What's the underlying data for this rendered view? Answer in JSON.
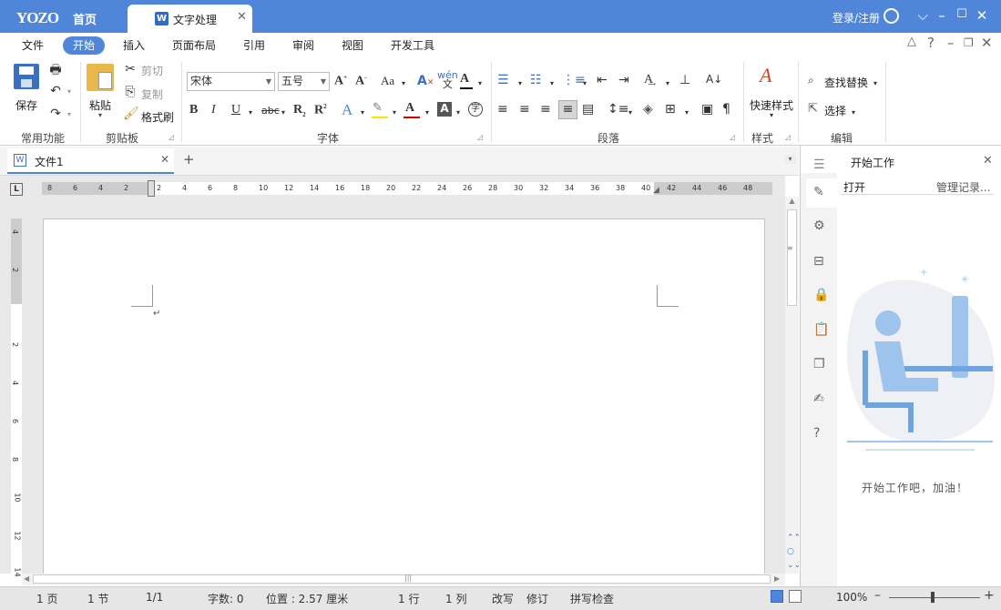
{
  "titlebar": {
    "logo": "YOZO",
    "home_tab": "首页",
    "doc_tab": "文字处理",
    "login": "登录/注册"
  },
  "menu": [
    "文件",
    "开始",
    "插入",
    "页面布局",
    "引用",
    "审阅",
    "视图",
    "开发工具"
  ],
  "active_menu": "开始",
  "ribbon": {
    "save": "保存",
    "group_common": "常用功能",
    "paste": "粘贴",
    "cut": "剪切",
    "copy": "复制",
    "format_painter": "格式刷",
    "group_clipboard": "剪贴板",
    "font_name": "宋体",
    "font_size": "五号",
    "group_font": "字体",
    "group_paragraph": "段落",
    "quick_style": "快速样式",
    "group_style": "样式",
    "find_replace": "查找替换",
    "select": "选择",
    "group_edit": "编辑",
    "colors": {
      "highlight": "#f5e600",
      "font_red": "#e00000",
      "accent": "#4f86d9"
    }
  },
  "document": {
    "tab": "文件1",
    "hruler": [
      "8",
      "6",
      "4",
      "2",
      "2",
      "4",
      "6",
      "8",
      "10",
      "12",
      "14",
      "16",
      "18",
      "20",
      "22",
      "24",
      "26",
      "28",
      "30",
      "32",
      "34",
      "36",
      "38",
      "40",
      "42",
      "44",
      "46",
      "48"
    ],
    "vruler": [
      "4",
      "2",
      "2",
      "4",
      "6",
      "8",
      "10",
      "12",
      "14"
    ]
  },
  "side_panel": {
    "title": "开始工作",
    "open": "打开",
    "manage": "管理记录...",
    "message": "开始工作吧，加油！"
  },
  "status": {
    "page": "1 页",
    "section": "1 节",
    "pages": "1/1",
    "words": "字数: 0",
    "position": "位置 : 2.57 厘米",
    "line": "1 行",
    "column": "1 列",
    "overwrite": "改写",
    "revise": "修订",
    "spell": "拼写检查",
    "zoom": "100%"
  }
}
